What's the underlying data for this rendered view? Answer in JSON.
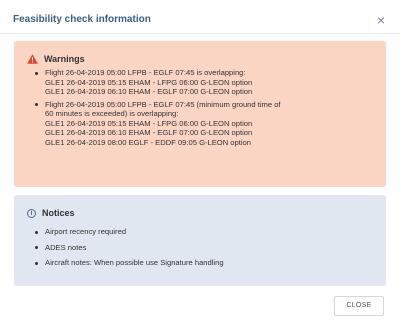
{
  "dialog": {
    "title": "Feasibility check information",
    "close_icon": "close-icon",
    "close_button_label": "CLOSE"
  },
  "warnings": {
    "title": "Warnings",
    "icon": "warning-triangle-icon",
    "items": [
      {
        "lines": [
          "Flight  26-04-2019 05:00 LFPB - EGLF 07:45 is overlapping:",
          "GLE1  26-04-2019 05:15 EHAM  -  LFPG 06:00 G-LEON option",
          "GLE1  26-04-2019 06:10 EHAM  -  EGLF 07:00 G-LEON option"
        ]
      },
      {
        "lines": [
          "Flight  26-04-2019 05:00 LFPB - EGLF 07:45 (minimum ground time of",
          "60 minutes is exceeded)  is overlapping:",
          "GLE1  26-04-2019 05:15 EHAM  -  LFPG 06:00 G-LEON option",
          "GLE1  26-04-2019 06:10 EHAM  -  EGLF 07:00 G-LEON option",
          "GLE1  26-04-2019 08:00 EGLF  -  EDDF 09:05 G-LEON option"
        ]
      }
    ]
  },
  "notices": {
    "title": "Notices",
    "icon": "info-circle-icon",
    "items": [
      "Airport recency required",
      "ADES notes",
      "Aircraft notes: When possible use Signature handling"
    ]
  },
  "colors": {
    "title_blue": "#3a5f88",
    "warnings_bg": "#fbd5c4",
    "warning_icon": "#e0452b",
    "notices_bg": "#e0e7f1"
  }
}
